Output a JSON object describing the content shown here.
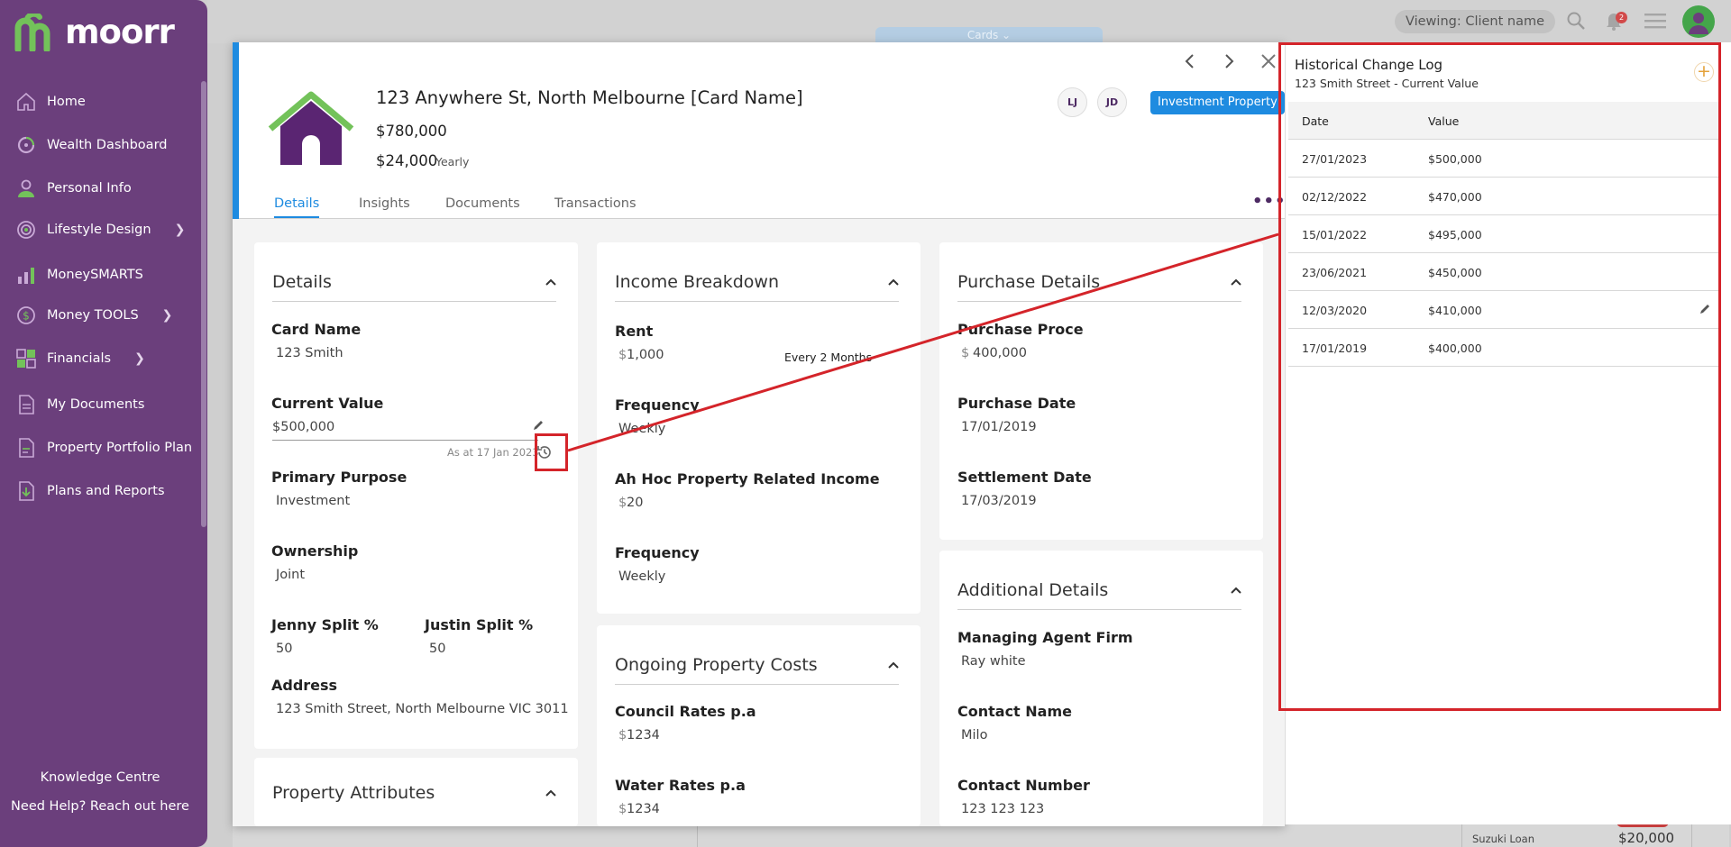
{
  "brand": {
    "name": "moorr",
    "logo_color": "#73c25a"
  },
  "sidebar": {
    "items": [
      {
        "label": "Home",
        "icon": "home-icon",
        "has_children": false
      },
      {
        "label": "Wealth Dashboard",
        "icon": "gauge-icon",
        "has_children": false
      },
      {
        "label": "Personal Info",
        "icon": "person-icon",
        "has_children": false
      },
      {
        "label": "Lifestyle Design",
        "icon": "target-icon",
        "has_children": true
      },
      {
        "label": "MoneySMARTS",
        "icon": "bar-chart-icon",
        "has_children": false
      },
      {
        "label": "Money TOOLS",
        "icon": "dollar-circle-icon",
        "has_children": true
      },
      {
        "label": "Financials",
        "icon": "grid-icon",
        "has_children": true
      },
      {
        "label": "My Documents",
        "icon": "document-icon",
        "has_children": false
      },
      {
        "label": "Property Portfolio Plan",
        "icon": "document-edit-icon",
        "has_children": false
      },
      {
        "label": "Plans and Reports",
        "icon": "report-download-icon",
        "has_children": false
      }
    ],
    "knowledge_centre": "Knowledge Centre",
    "help_text": "Need Help? Reach out here"
  },
  "topbar": {
    "viewing": "Viewing: Client name",
    "notification_count": "2"
  },
  "cards_tab": {
    "label": "Cards"
  },
  "background": {
    "loan_label": "Suzuki Loan",
    "loan_value": "$20,000"
  },
  "card": {
    "title": "123 Anywhere St, North Melbourne [Card Name]",
    "value": "$780,000",
    "income": "$24,000",
    "income_period": "Yearly",
    "initials": [
      "LJ",
      "JD"
    ],
    "badge": "Investment Property",
    "tabs": [
      "Details",
      "Insights",
      "Documents",
      "Transactions"
    ],
    "active_tab": "Details"
  },
  "details": {
    "title": "Details",
    "card_name_label": "Card Name",
    "card_name": "123 Smith",
    "current_value_label": "Current Value",
    "current_value": "$500,000",
    "as_at": "As at 17 Jan 2023",
    "primary_purpose_label": "Primary Purpose",
    "primary_purpose": "Investment",
    "ownership_label": "Ownership",
    "ownership": "Joint",
    "split1_label": "Jenny Split %",
    "split1": "50",
    "split2_label": "Justin Split %",
    "split2": "50",
    "address_label": "Address",
    "address": "123 Smith Street, North Melbourne VIC 3011"
  },
  "property_attributes": {
    "title": "Property Attributes"
  },
  "income_breakdown": {
    "title": "Income Breakdown",
    "rent_label": "Rent",
    "rent_currency": "$",
    "rent": "1,000",
    "rent_frequency": "Every 2 Months",
    "frequency_label": "Frequency",
    "frequency": "Weekly",
    "adhoc_label": "Ah Hoc Property Related Income",
    "adhoc_currency": "$",
    "adhoc": "20",
    "frequency2_label": "Frequency",
    "frequency2": "Weekly"
  },
  "ongoing_costs": {
    "title": "Ongoing Property Costs",
    "council_label": "Council Rates p.a",
    "council_currency": "$",
    "council": "1234",
    "water_label": "Water Rates p.a",
    "water_currency": "$",
    "water": "1234"
  },
  "purchase_details": {
    "title": "Purchase Details",
    "price_label": "Purchase Proce",
    "price_currency": "$",
    "price": "400,000",
    "date_label": "Purchase Date",
    "date": "17/01/2019",
    "settlement_label": "Settlement Date",
    "settlement": "17/03/2019"
  },
  "additional_details": {
    "title": "Additional Details",
    "agent_label": "Managing Agent Firm",
    "agent": "Ray white",
    "contact_label": "Contact Name",
    "contact": "Milo",
    "number_label": "Contact Number",
    "number": "123 123 123"
  },
  "history": {
    "title": "Historical Change Log",
    "subtitle": "123 Smith Street - Current Value",
    "columns": [
      "Date",
      "Value"
    ],
    "rows": [
      {
        "date": "27/01/2023",
        "value": "$500,000"
      },
      {
        "date": "02/12/2022",
        "value": "$470,000"
      },
      {
        "date": "15/01/2022",
        "value": "$495,000"
      },
      {
        "date": "23/06/2021",
        "value": "$450,000"
      },
      {
        "date": "12/03/2020",
        "value": "$410,000"
      },
      {
        "date": "17/01/2019",
        "value": "$400,000"
      }
    ]
  },
  "colors": {
    "accent": "#1e8be0",
    "sidebar": "#6b3f7c",
    "annotation": "#d4242a",
    "house": "#5a2572"
  }
}
